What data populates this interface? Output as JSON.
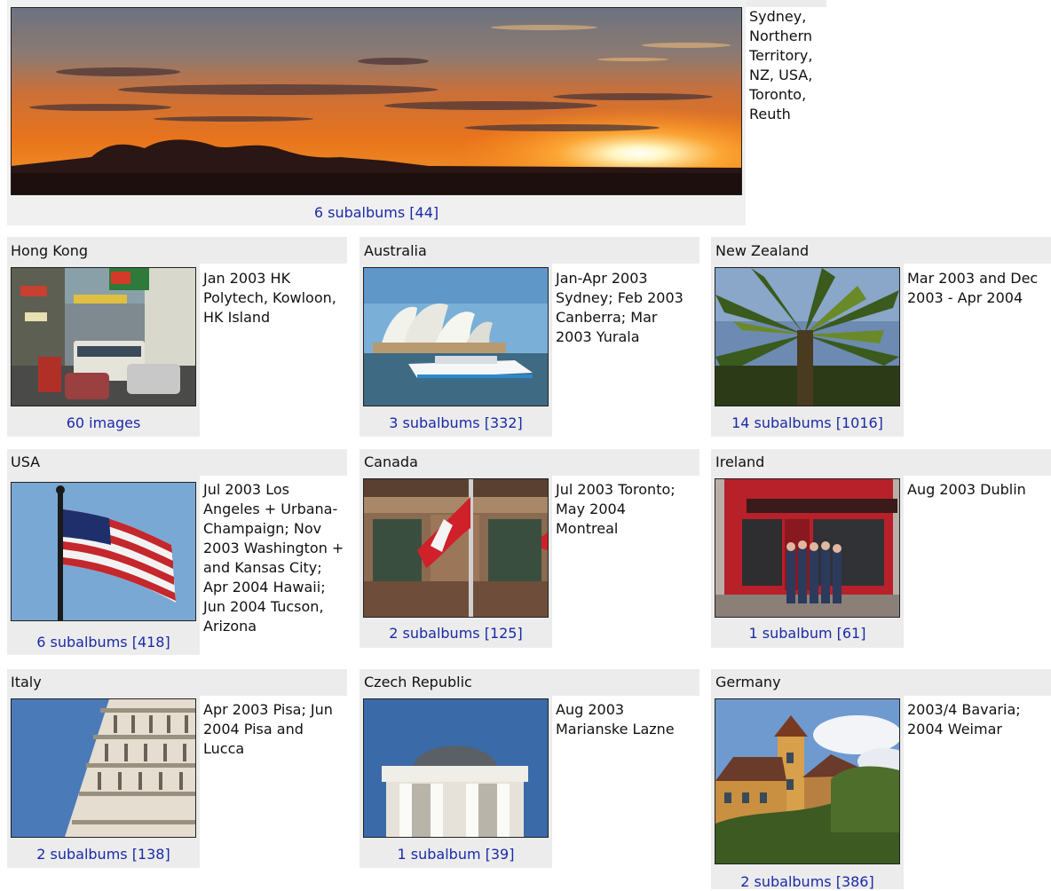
{
  "top": {
    "description": "Sydney, Northern Territory, NZ, USA, Toronto, Reuth",
    "link": "6 subalbums [44]"
  },
  "albums": [
    {
      "title": "Hong Kong",
      "description": "Jan 2003 HK Polytech, Kowloon, HK Island",
      "link": "60 images",
      "thumb": "hong-kong-street-photo"
    },
    {
      "title": "Australia",
      "description": "Jan-Apr 2003 Sydney; Feb 2003 Canberra; Mar 2003 Yurala",
      "link": "3 subalbums [332]",
      "thumb": "sydney-opera-house-photo"
    },
    {
      "title": "New Zealand",
      "description": "Mar 2003 and Dec 2003 - Apr 2004",
      "link": "14 subalbums [1016]",
      "thumb": "tree-fern-photo"
    },
    {
      "title": "USA",
      "description": "Jul 2003 Los Angeles + Urbana-Champaign; Nov 2003 Washington + and Kansas City; Apr 2004 Hawaii; Jun 2004 Tucson, Arizona",
      "link": "6 subalbums [418]",
      "thumb": "us-flag-photo"
    },
    {
      "title": "Canada",
      "description": "Jul 2003 Toronto; May 2004 Montreal",
      "link": "2 subalbums [125]",
      "thumb": "canada-flag-photo"
    },
    {
      "title": "Ireland",
      "description": "Aug 2003 Dublin",
      "link": "1 subalbum [61]",
      "thumb": "temple-bar-photo"
    },
    {
      "title": "Italy",
      "description": "Apr 2003 Pisa; Jun 2004 Pisa and Lucca",
      "link": "2 subalbums [138]",
      "thumb": "leaning-tower-photo"
    },
    {
      "title": "Czech Republic",
      "description": "Aug 2003 Marianske Lazne",
      "link": "1 subalbum [39]",
      "thumb": "colonnade-dome-photo"
    },
    {
      "title": "Germany",
      "description": "2003/4 Bavaria; 2004 Weimar",
      "link": "2 subalbums [386]",
      "thumb": "bavarian-castle-photo"
    }
  ]
}
